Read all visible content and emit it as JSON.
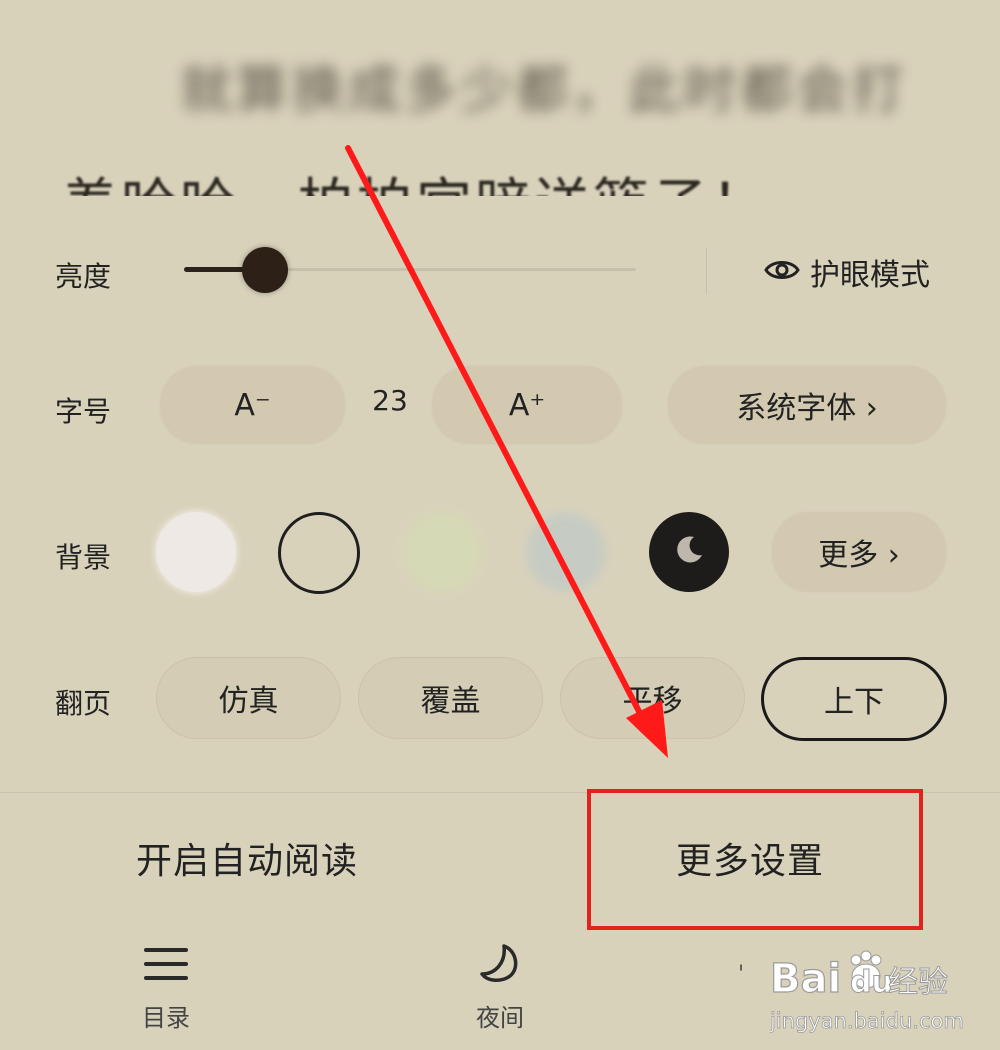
{
  "reader_text": {
    "line1": "就算换成多少都，此时都会打",
    "line2": "羞哈哈，柏柏宫暗送篮子！"
  },
  "brightness": {
    "label": "亮度",
    "level": 0.18,
    "eye_mode_label": "护眼模式"
  },
  "font": {
    "label": "字号",
    "decrease_label": "A⁻",
    "size_value": "23",
    "increase_label": "A⁺",
    "family_label": "系统字体 ›"
  },
  "background": {
    "label": "背景",
    "options": [
      "white",
      "outline",
      "green",
      "blue",
      "dark"
    ],
    "more_label": "更多 ›"
  },
  "page_turn": {
    "label": "翻页",
    "options": [
      "仿真",
      "覆盖",
      "平移",
      "上下"
    ],
    "selected": "上下"
  },
  "actions": {
    "auto_read_label": "开启自动阅读",
    "more_settings_label": "更多设置"
  },
  "bottom_nav": {
    "toc_label": "目录",
    "night_label": "夜间",
    "dot": "'"
  },
  "watermark": {
    "brand": "Bai",
    "brand2": "du",
    "jingyan": "经验",
    "url": "jingyan.baidu.com"
  },
  "colors": {
    "background": "#d9d2bb",
    "highlight": "#e3231b",
    "arrow": "#ff1a1a"
  },
  "icons": {
    "eye": "eye-icon",
    "moon": "moon-icon",
    "menu": "menu-icon",
    "chevron": "chevron-right-icon"
  }
}
